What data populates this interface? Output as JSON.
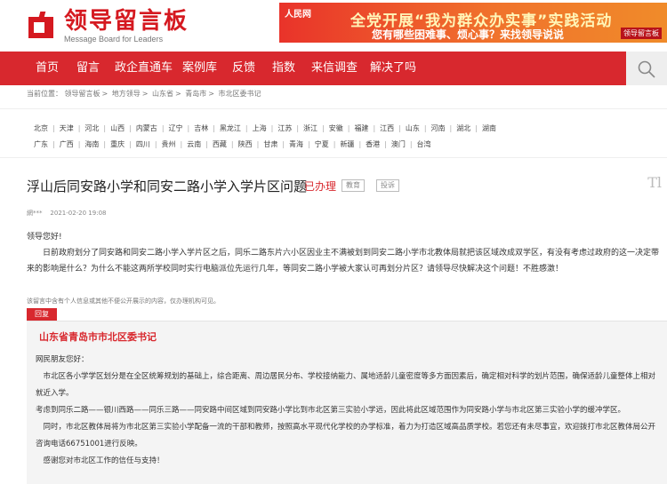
{
  "header": {
    "logo_cn": "领导留言板",
    "logo_en": "Message Board for Leaders",
    "banner": {
      "source": "人民网",
      "line1": "全党开展“我为群众办实事”实践活动",
      "line2": "您有哪些困难事、烦心事？来找领导说说",
      "tag": "领导留言板"
    }
  },
  "nav": {
    "items": [
      "首页",
      "留言",
      "政企直通车",
      "案例库",
      "反馈",
      "指数",
      "来信调查",
      "解决了吗"
    ],
    "search_icon": "search-icon"
  },
  "breadcrumb": {
    "prefix": "当前位置：",
    "items": [
      "领导留言板",
      "地方领导",
      "山东省",
      "青岛市",
      "市北区委书记"
    ]
  },
  "regions": {
    "row1": [
      "北京",
      "天津",
      "河北",
      "山西",
      "内蒙古",
      "辽宁",
      "吉林",
      "黑龙江",
      "上海",
      "江苏",
      "浙江",
      "安徽",
      "福建",
      "江西",
      "山东",
      "河南",
      "湖北",
      "湖南"
    ],
    "row2": [
      "广东",
      "广西",
      "海南",
      "重庆",
      "四川",
      "贵州",
      "云南",
      "西藏",
      "陕西",
      "甘肃",
      "青海",
      "宁夏",
      "新疆",
      "香港",
      "澳门",
      "台湾"
    ]
  },
  "message": {
    "title": "浮山后同安路小学和同安二路小学入学片区问题",
    "status": "已办理",
    "tags": [
      "教育",
      "投诉"
    ],
    "corner": "Tl",
    "author": "網***",
    "date": "2021-02-20 19:08",
    "greeting": "领导您好!",
    "content": "日前政府划分了同安路和同安二路小学入学片区之后，同乐二路东片六小区因业主不满被划到同安二路小学市北教体局就把该区域改成双学区，有没有考虑过政府的这一决定带来的影响是什么？为什么不能这两所学校同时实行电脑派位先运行几年，等同安二路小学被大家认可再划分片区？请领导尽快解决这个问题！不胜感激！",
    "notice": "该留言中含有个人信息或其他不便公开展示的内容，仅办理机构可见。"
  },
  "reply": {
    "label": "回复",
    "org": "山东省青岛市市北区委书记",
    "p1": "网民朋友您好：",
    "p2": "市北区各小学学区划分是在全区统筹规划的基础上，综合距离、周边居民分布、学校接纳能力、属地适龄儿童密度等多方面因素后，确定相对科学的划片范围，确保适龄儿童整体上相对就近入学。",
    "p3": "考虑到同乐二路——银川西路——同乐三路——同安路中间区域到同安路小学比到市北区第三实验小学远，因此将此区域范围作为同安路小学与市北区第三实验小学的缓冲学区。",
    "p4": "同时，市北区教体局将为市北区第三实验小学配备一流的干部和教师，按照高水平现代化学校的办学标准，着力为打造区域高品质学校。若您还有未尽事宜，欢迎拨打市北区教体局公开咨询电话66751001进行反映。",
    "p5": "感谢您对市北区工作的信任与支持！"
  },
  "colors": {
    "brand_red": "#d8282e"
  }
}
